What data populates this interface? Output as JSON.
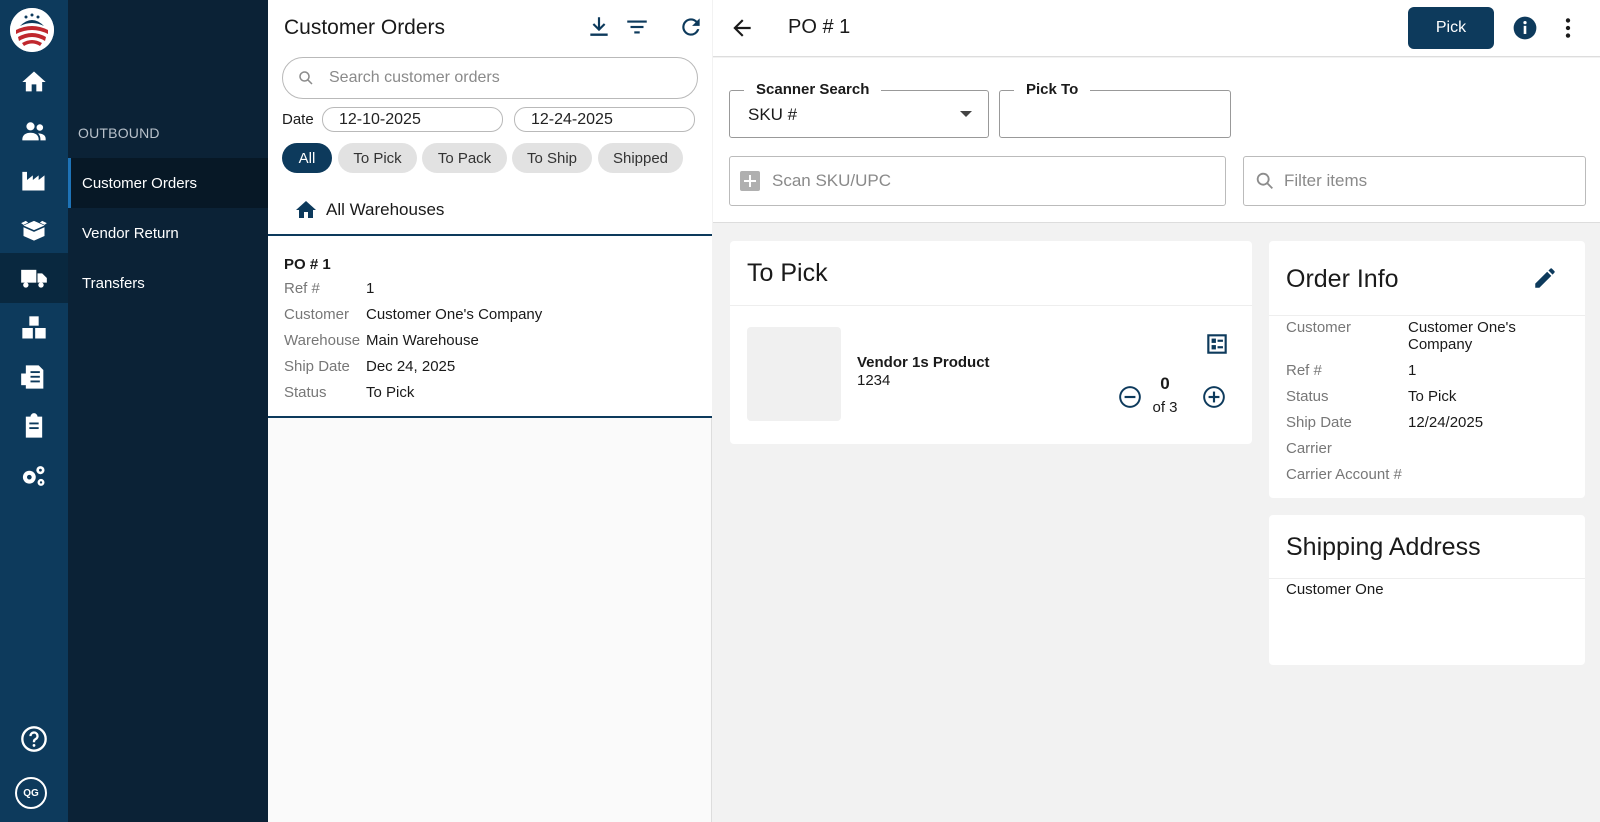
{
  "colors": {
    "primary": "#0d3a5c",
    "rail": "#0d3a5c",
    "subnav": "#0b2236"
  },
  "rail": {
    "icons": [
      "logo-eagle-flag",
      "home-icon",
      "users-icon",
      "factory-icon",
      "open-box-icon",
      "truck-icon",
      "boxes-icon",
      "invoice-icon",
      "clipboard-icon",
      "settings-gears-icon",
      "help-icon"
    ],
    "avatar": "QG"
  },
  "subnav": {
    "section": "OUTBOUND",
    "items": [
      {
        "label": "Customer Orders",
        "active": true
      },
      {
        "label": "Vendor Return",
        "active": false
      },
      {
        "label": "Transfers",
        "active": false
      }
    ]
  },
  "list": {
    "title": "Customer Orders",
    "search_placeholder": "Search customer orders",
    "date_label": "Date",
    "date_from": "12-10-2025",
    "date_to": "12-24-2025",
    "filters": [
      {
        "label": "All",
        "active": true
      },
      {
        "label": "To Pick",
        "active": false
      },
      {
        "label": "To Pack",
        "active": false
      },
      {
        "label": "To Ship",
        "active": false
      },
      {
        "label": "Shipped",
        "active": false
      }
    ],
    "warehouse": "All Warehouses",
    "orders": [
      {
        "title": "PO # 1",
        "fields": [
          {
            "k": "Ref #",
            "v": "1"
          },
          {
            "k": "Customer",
            "v": "Customer One's Company"
          },
          {
            "k": "Warehouse",
            "v": "Main Warehouse"
          },
          {
            "k": "Ship Date",
            "v": "Dec 24, 2025"
          },
          {
            "k": "Status",
            "v": "To Pick"
          }
        ]
      }
    ]
  },
  "detail": {
    "title": "PO # 1",
    "pick_button": "Pick",
    "scanner_search_label": "Scanner Search",
    "scanner_search_value": "SKU #",
    "pick_to_label": "Pick To",
    "scan_placeholder": "Scan SKU/UPC",
    "filter_placeholder": "Filter items",
    "to_pick": {
      "title": "To Pick",
      "items": [
        {
          "name": "Vendor 1s Product",
          "sku": "1234",
          "qty": "0",
          "of": "of 3"
        }
      ]
    },
    "order_info": {
      "title": "Order Info",
      "rows": [
        {
          "k": "Customer",
          "v": "Customer One's Company"
        },
        {
          "k": "Ref #",
          "v": "1"
        },
        {
          "k": "Status",
          "v": "To Pick"
        },
        {
          "k": "Ship Date",
          "v": "12/24/2025"
        },
        {
          "k": "Carrier",
          "v": ""
        },
        {
          "k": "Carrier Account #",
          "v": ""
        }
      ]
    },
    "shipping_address": {
      "title": "Shipping Address",
      "line1": "Customer One"
    }
  }
}
